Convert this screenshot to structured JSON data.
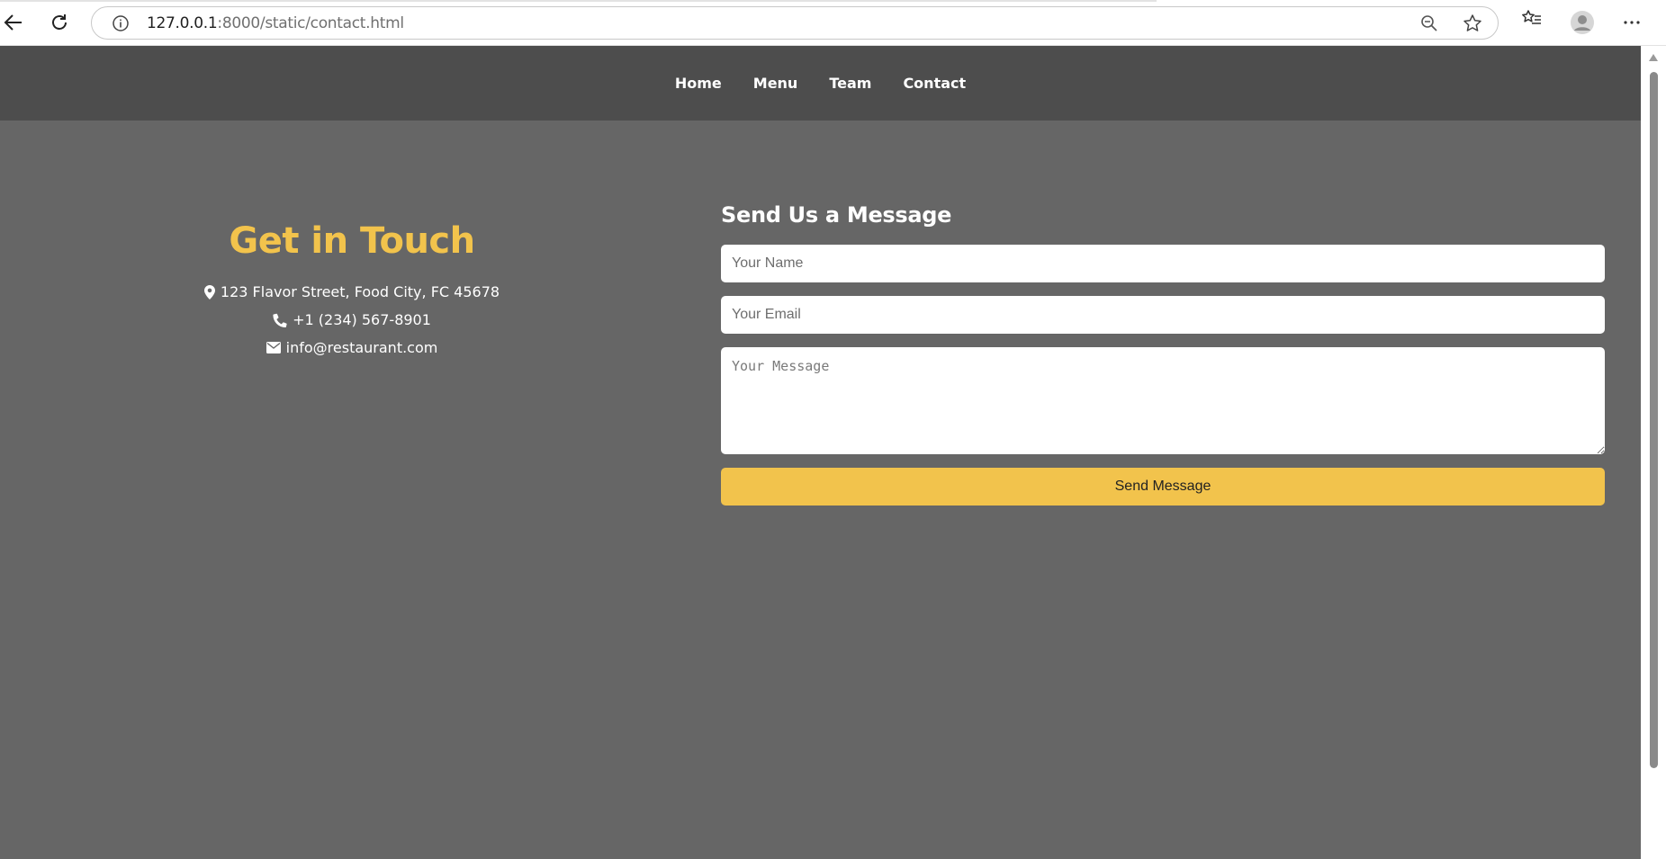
{
  "browser": {
    "url_host": "127.0.0.1",
    "url_path": ":8000/static/contact.html"
  },
  "nav": {
    "items": [
      "Home",
      "Menu",
      "Team",
      "Contact"
    ]
  },
  "contact": {
    "title": "Get in Touch",
    "address": "123 Flavor Street, Food City, FC 45678",
    "phone": "+1 (234) 567-8901",
    "email": "info@restaurant.com"
  },
  "form": {
    "title": "Send Us a Message",
    "name_placeholder": "Your Name",
    "email_placeholder": "Your Email",
    "message_placeholder": "Your Message",
    "submit_label": "Send Message"
  },
  "colors": {
    "accent": "#f2c34c",
    "page_background": "#666666",
    "nav_background": "#4d4d4d"
  }
}
